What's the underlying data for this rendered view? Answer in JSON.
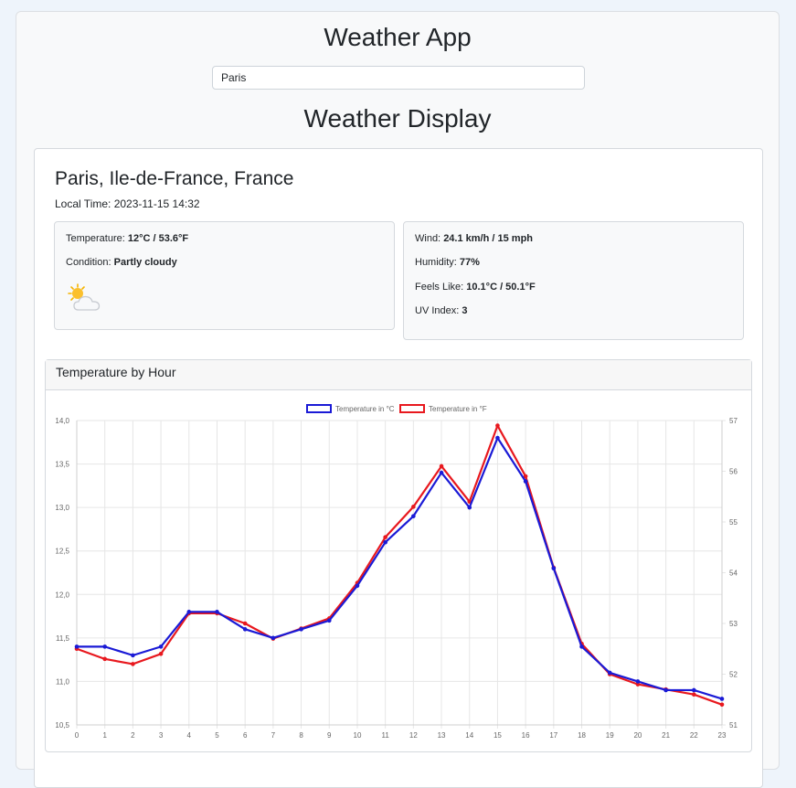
{
  "app": {
    "title": "Weather App"
  },
  "search": {
    "value": "Paris"
  },
  "display": {
    "title": "Weather Display"
  },
  "weather": {
    "location": "Paris, Ile-de-France, France",
    "local_time_label": "Local Time:",
    "local_time": "2023-11-15 14:32",
    "temperature_label": "Temperature:",
    "temperature": "12°C / 53.6°F",
    "condition_label": "Condition:",
    "condition": "Partly cloudy",
    "condition_icon": "partly-cloudy-icon",
    "wind_label": "Wind:",
    "wind": "24.1 km/h / 15 mph",
    "humidity_label": "Humidity:",
    "humidity": "77%",
    "feels_like_label": "Feels Like:",
    "feels_like": "10.1°C / 50.1°F",
    "uv_label": "UV Index:",
    "uv": "3"
  },
  "chart_section": {
    "title": "Temperature by Hour"
  },
  "chart_data": {
    "type": "line",
    "title": "",
    "x": [
      0,
      1,
      2,
      3,
      4,
      5,
      6,
      7,
      8,
      9,
      10,
      11,
      12,
      13,
      14,
      15,
      16,
      17,
      18,
      19,
      20,
      21,
      22,
      23
    ],
    "series": [
      {
        "name": "Temperature in °C",
        "axis": "left",
        "color": "#1a1ad6",
        "values": [
          11.4,
          11.4,
          11.3,
          11.4,
          11.8,
          11.8,
          11.6,
          11.5,
          11.6,
          11.7,
          12.1,
          12.6,
          12.9,
          13.4,
          13.0,
          13.8,
          13.3,
          12.3,
          11.4,
          11.1,
          11.0,
          10.9,
          10.9,
          10.8
        ]
      },
      {
        "name": "Temperature in °F",
        "axis": "right",
        "color": "#e8181e",
        "values": [
          52.5,
          52.3,
          52.2,
          52.4,
          53.2,
          53.2,
          53.0,
          52.7,
          52.9,
          53.1,
          53.8,
          54.7,
          55.3,
          56.1,
          55.4,
          56.9,
          55.9,
          54.1,
          52.6,
          52.0,
          51.8,
          51.7,
          51.6,
          51.4
        ]
      }
    ],
    "left_axis": {
      "min": 10.5,
      "max": 14.0,
      "ticks": [
        "10,5",
        "11,0",
        "11,5",
        "12,0",
        "12,5",
        "13,0",
        "13,5",
        "14,0"
      ]
    },
    "right_axis": {
      "min": 51,
      "max": 57,
      "ticks": [
        "51",
        "52",
        "53",
        "54",
        "55",
        "56",
        "57"
      ]
    },
    "grid": true,
    "legend": "top-center"
  }
}
